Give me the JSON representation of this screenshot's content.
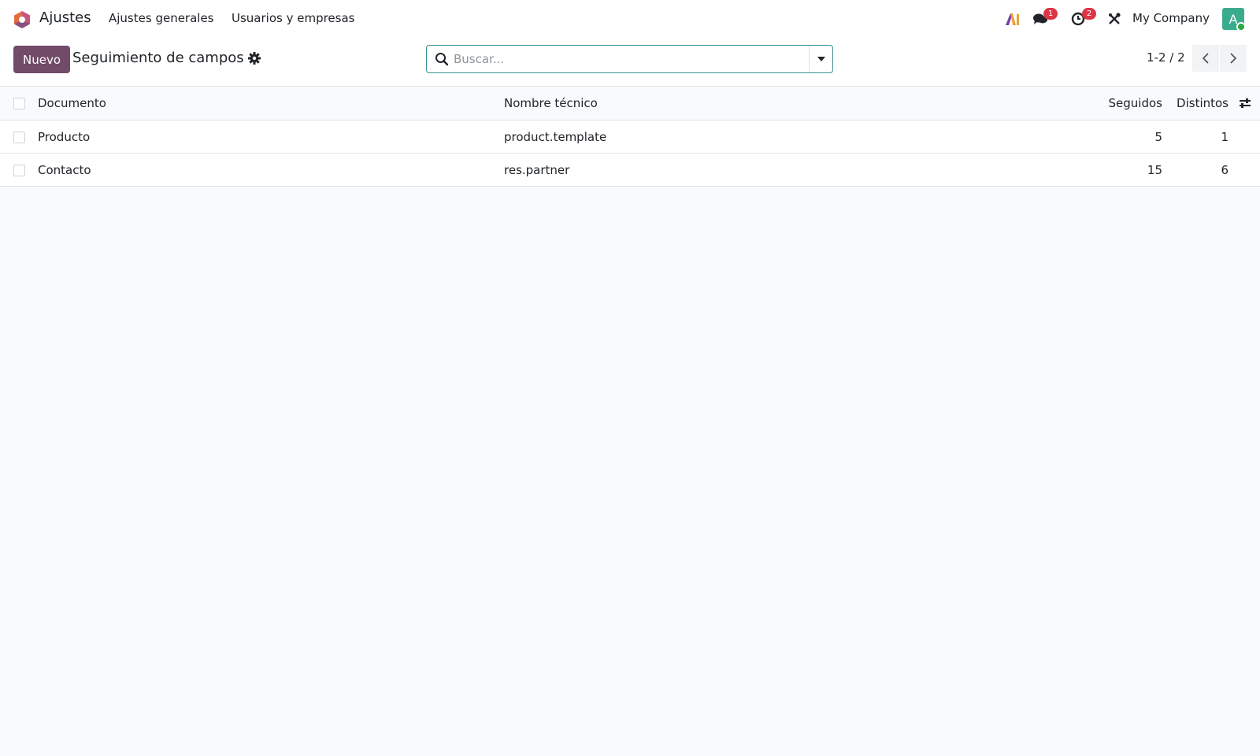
{
  "navbar": {
    "app_name": "Ajustes",
    "menu": [
      {
        "label": "Ajustes generales"
      },
      {
        "label": "Usuarios y empresas"
      }
    ],
    "messages_badge": "1",
    "activity_badge": "2",
    "company": "My Company",
    "avatar_letter": "A"
  },
  "control_panel": {
    "new_label": "Nuevo",
    "title": "Seguimiento de campos",
    "search_placeholder": "Buscar...",
    "pager": "1-2 / 2"
  },
  "list": {
    "headers": {
      "document": "Documento",
      "technical_name": "Nombre técnico",
      "followed": "Seguidos",
      "distinct": "Distintos"
    },
    "rows": [
      {
        "document": "Producto",
        "technical_name": "product.template",
        "followed": "5",
        "distinct": "1"
      },
      {
        "document": "Contacto",
        "technical_name": "res.partner",
        "followed": "15",
        "distinct": "6"
      }
    ]
  },
  "colors": {
    "primary": "#714b67",
    "accent": "#3a8f8f",
    "badge": "#dc3545",
    "avatar": "#3bab8e"
  }
}
